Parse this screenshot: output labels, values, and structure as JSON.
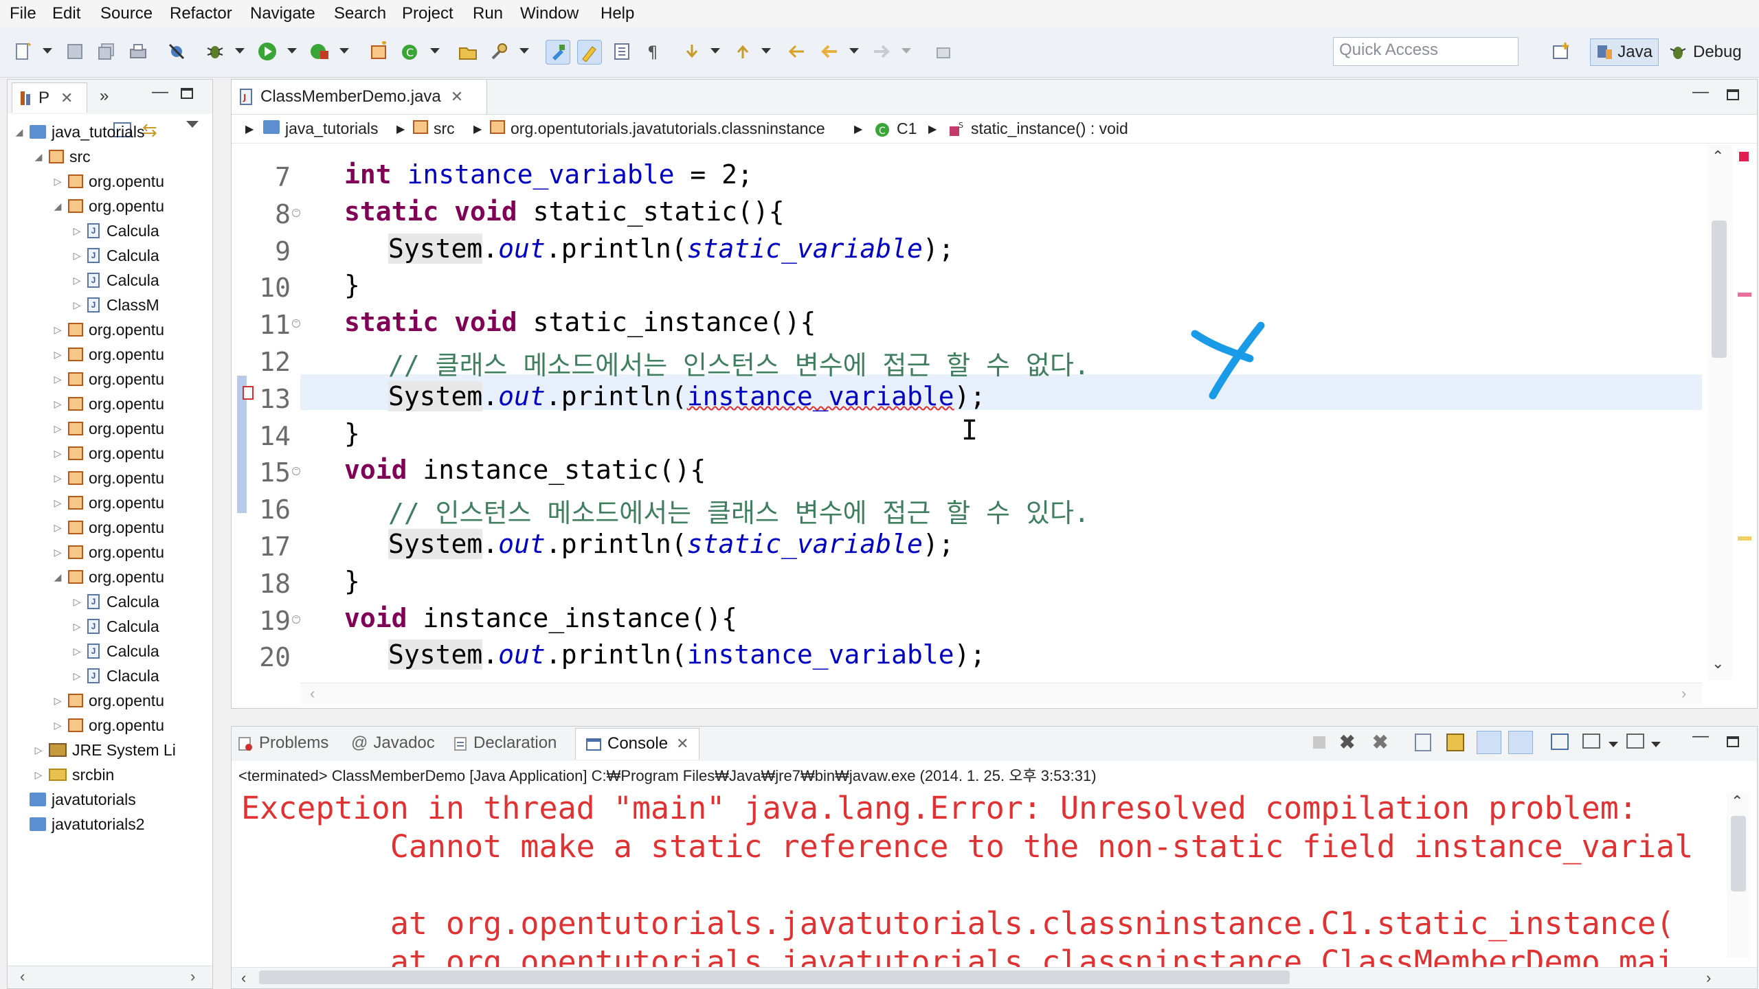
{
  "menu": [
    "File",
    "Edit",
    "Source",
    "Refactor",
    "Navigate",
    "Search",
    "Project",
    "Run",
    "Window",
    "Help"
  ],
  "toolbar": {
    "quick_access_placeholder": "Quick Access",
    "persp_java": "Java",
    "persp_debug": "Debug"
  },
  "left_panel": {
    "tab_label": "P",
    "tree": [
      {
        "label": "java_tutorials",
        "type": "project",
        "expanded": true
      },
      {
        "label": "src",
        "type": "srcfolder",
        "expanded": true
      },
      {
        "label": "org.opentu",
        "type": "package"
      },
      {
        "label": "org.opentu",
        "type": "package",
        "expanded": true
      },
      {
        "label": "Calcula",
        "type": "java"
      },
      {
        "label": "Calcula",
        "type": "java"
      },
      {
        "label": "Calcula",
        "type": "java"
      },
      {
        "label": "ClassM",
        "type": "java"
      },
      {
        "label": "org.opentu",
        "type": "package"
      },
      {
        "label": "org.opentu",
        "type": "package"
      },
      {
        "label": "org.opentu",
        "type": "package"
      },
      {
        "label": "org.opentu",
        "type": "package"
      },
      {
        "label": "org.opentu",
        "type": "package"
      },
      {
        "label": "org.opentu",
        "type": "package"
      },
      {
        "label": "org.opentu",
        "type": "package"
      },
      {
        "label": "org.opentu",
        "type": "package"
      },
      {
        "label": "org.opentu",
        "type": "package"
      },
      {
        "label": "org.opentu",
        "type": "package"
      },
      {
        "label": "org.opentu",
        "type": "package",
        "expanded": true
      },
      {
        "label": "Calcula",
        "type": "java"
      },
      {
        "label": "Calcula",
        "type": "java"
      },
      {
        "label": "Calcula",
        "type": "java"
      },
      {
        "label": "Clacula",
        "type": "java"
      },
      {
        "label": "org.opentu",
        "type": "package"
      },
      {
        "label": "org.opentu",
        "type": "package"
      },
      {
        "label": "JRE System Li",
        "type": "library"
      },
      {
        "label": "srcbin",
        "type": "folder"
      },
      {
        "label": "javatutorials",
        "type": "project"
      },
      {
        "label": "javatutorials2",
        "type": "project"
      }
    ]
  },
  "editor": {
    "tab_title": "ClassMemberDemo.java",
    "breadcrumb": [
      "java_tutorials",
      "src",
      "org.opentutorials.javatutorials.classninstance",
      "C1",
      "static_instance() : void"
    ],
    "lines": [
      {
        "n": "7"
      },
      {
        "n": "8"
      },
      {
        "n": "9"
      },
      {
        "n": "10"
      },
      {
        "n": "11"
      },
      {
        "n": "12"
      },
      {
        "n": "13"
      },
      {
        "n": "14"
      },
      {
        "n": "15"
      },
      {
        "n": "16"
      },
      {
        "n": "17"
      },
      {
        "n": "18"
      },
      {
        "n": "19"
      },
      {
        "n": "20"
      }
    ],
    "code": {
      "l7": {
        "kw": "int",
        "rest": " instance_variable = 2;"
      },
      "l8": {
        "kw1": "static",
        "kw2": "void",
        "rest": " static_static(){"
      },
      "l9": {
        "sys": "System",
        "out": "out",
        "call": ".println(",
        "arg": "static_variable",
        "end": ");"
      },
      "l10": "}",
      "l11": {
        "kw1": "static",
        "kw2": "void",
        "rest": " static_instance(){"
      },
      "l12": "// 클래스 메소드에서는 인스턴스 변수에 접근 할 수 없다.",
      "l13": {
        "sys": "System",
        "out": "out",
        "call": ".println(",
        "arg": "instance_variable",
        "end": ");"
      },
      "l14": "}",
      "l15": {
        "kw": "void",
        "rest": " instance_static(){"
      },
      "l16": "// 인스턴스 메소드에서는 클래스 변수에 접근 할 수 있다.",
      "l17": {
        "sys": "System",
        "out": "out",
        "call": ".println(",
        "arg": "static_variable",
        "end": ");"
      },
      "l18": "}",
      "l19": {
        "kw": "void",
        "rest": " instance_instance(){"
      },
      "l20": {
        "sys": "System",
        "out": "out",
        "call": ".println(",
        "arg": "instance_variable",
        "end": ");"
      }
    }
  },
  "console": {
    "tabs": [
      "Problems",
      "Javadoc",
      "Declaration",
      "Console"
    ],
    "status": "<terminated> ClassMemberDemo [Java Application] C:₩Program Files₩Java₩jre7₩bin₩javaw.exe (2014. 1. 25. 오후 3:53:31)",
    "output": [
      "Exception in thread \"main\" java.lang.Error: Unresolved compilation problem:",
      "        Cannot make a static reference to the non-static field instance_varial",
      "",
      "        at org.opentutorials.javatutorials.classninstance.C1.static_instance(",
      "        at org.opentutorials.javatutorials.classninstance.ClassMemberDemo.mai"
    ]
  },
  "colors": {
    "keyword": "#7f0055",
    "field": "#0000c0",
    "comment": "#3f7f5f",
    "error_text": "#e03232",
    "annotation_mark": "#1a9be8"
  }
}
